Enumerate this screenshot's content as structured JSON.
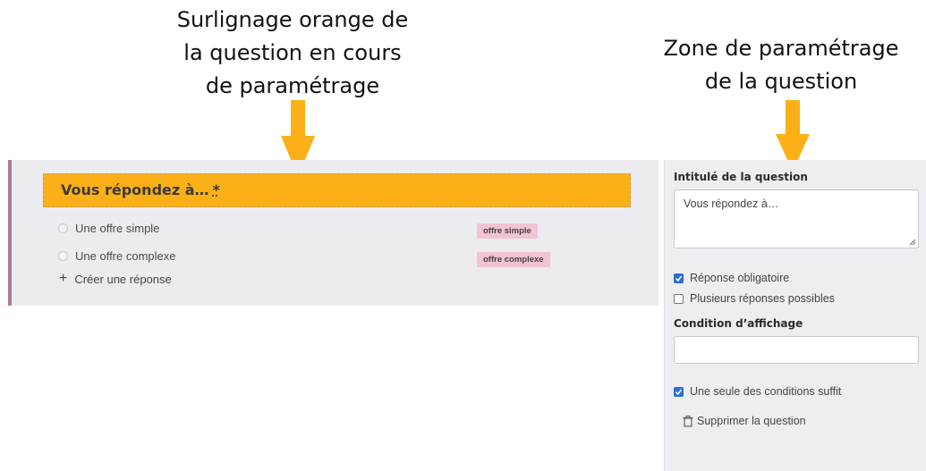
{
  "annotations": {
    "left": [
      "Surlignage orange de",
      "la question en cours",
      "de paramétrage"
    ],
    "right": [
      "Zone de paramétrage",
      "de la question"
    ]
  },
  "editor": {
    "question_title": "Vous répondez à…",
    "required_mark": "*",
    "answers": [
      {
        "label": "Une offre simple",
        "tag": "offre simple"
      },
      {
        "label": "Une offre complexe",
        "tag": "offre complexe"
      }
    ],
    "add_answer_label": "Créer une réponse"
  },
  "settings": {
    "title_label": "Intitulé de la question",
    "title_value": "Vous répondez à…",
    "required_label": "Réponse obligatoire",
    "required_checked": true,
    "multiple_label": "Plusieurs réponses possibles",
    "multiple_checked": false,
    "condition_label": "Condition d’affichage",
    "condition_value": "",
    "single_condition_label": "Une seule des conditions suffit",
    "single_condition_checked": true,
    "delete_label": "Supprimer la question"
  },
  "colors": {
    "highlight": "#fbb018",
    "arrow": "#fbb018",
    "tag_bg": "#f2c3d3",
    "checkbox": "#2a6edb"
  },
  "icons": [
    "arrow-down-icon",
    "plus-icon",
    "checkbox-icon",
    "trash-icon",
    "resize-grip-icon"
  ]
}
